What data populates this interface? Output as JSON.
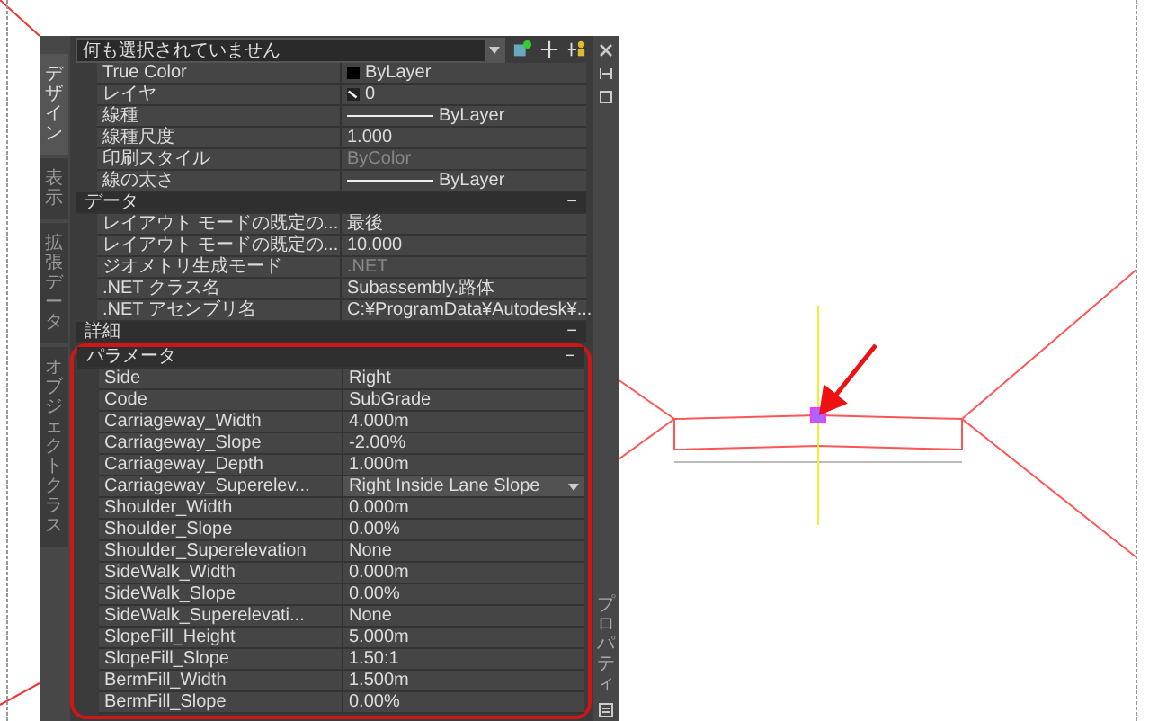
{
  "palette": {
    "selection": "何も選択されていません",
    "side_tabs": [
      {
        "label": "デザイン",
        "selected": true
      },
      {
        "label": "表示",
        "selected": false
      },
      {
        "label": "拡張データ",
        "selected": false
      },
      {
        "label": "オブジェクトクラス",
        "selected": false
      }
    ],
    "side_title": "プロパティ",
    "general_rows": [
      {
        "label": "True Color",
        "value": "ByLayer",
        "kind": "color",
        "disabled": false
      },
      {
        "label": "レイヤ",
        "value": "0",
        "kind": "layer",
        "disabled": false
      },
      {
        "label": "線種",
        "value": "ByLayer",
        "kind": "linetype",
        "disabled": false
      },
      {
        "label": "線種尺度",
        "value": "1.000",
        "kind": "text",
        "disabled": false
      },
      {
        "label": "印刷スタイル",
        "value": "ByColor",
        "kind": "text",
        "disabled": true
      },
      {
        "label": "線の太さ",
        "value": "ByLayer",
        "kind": "linetype",
        "disabled": false
      }
    ],
    "sections": [
      {
        "title": "データ",
        "toggle": "−",
        "highlighted": false,
        "rows": [
          {
            "label": "レイアウト モードの既定の...",
            "value": "最後",
            "kind": "text",
            "disabled": false
          },
          {
            "label": "レイアウト モードの既定の...",
            "value": "10.000",
            "kind": "text",
            "disabled": false
          },
          {
            "label": "ジオメトリ生成モード",
            "value": ".NET",
            "kind": "text",
            "disabled": true
          },
          {
            "label": ".NET クラス名",
            "value": "Subassembly.路体",
            "kind": "text",
            "disabled": false
          },
          {
            "label": ".NET アセンブリ名",
            "value": "C:¥ProgramData¥Autodesk¥...",
            "kind": "text",
            "disabled": false
          }
        ]
      },
      {
        "title": "詳細",
        "toggle": "−",
        "highlighted": false
      },
      {
        "title": "パラメータ",
        "toggle": "−",
        "highlighted": true,
        "rows": [
          {
            "label": "Side",
            "value": "Right",
            "kind": "text",
            "disabled": false
          },
          {
            "label": "Code",
            "value": "SubGrade",
            "kind": "text",
            "disabled": false
          },
          {
            "label": "Carriageway_Width",
            "value": "4.000m",
            "kind": "text",
            "disabled": false
          },
          {
            "label": "Carriageway_Slope",
            "value": "-2.00%",
            "kind": "text",
            "disabled": false
          },
          {
            "label": "Carriageway_Depth",
            "value": "1.000m",
            "kind": "text",
            "disabled": false
          },
          {
            "label": "Carriageway_Superelev...",
            "value": "Right Inside Lane Slope",
            "kind": "dropdown",
            "disabled": false
          },
          {
            "label": "Shoulder_Width",
            "value": "0.000m",
            "kind": "text",
            "disabled": false
          },
          {
            "label": "Shoulder_Slope",
            "value": "0.00%",
            "kind": "text",
            "disabled": false
          },
          {
            "label": "Shoulder_Superelevation",
            "value": "None",
            "kind": "text",
            "disabled": false
          },
          {
            "label": "SideWalk_Width",
            "value": "0.000m",
            "kind": "text",
            "disabled": false
          },
          {
            "label": "SideWalk_Slope",
            "value": "0.00%",
            "kind": "text",
            "disabled": false
          },
          {
            "label": "SideWalk_Superelevati...",
            "value": "None",
            "kind": "text",
            "disabled": false
          },
          {
            "label": "SlopeFill_Height",
            "value": "5.000m",
            "kind": "text",
            "disabled": false
          },
          {
            "label": "SlopeFill_Slope",
            "value": "1.50:1",
            "kind": "text",
            "disabled": false
          },
          {
            "label": "BermFill_Width",
            "value": "1.500m",
            "kind": "text",
            "disabled": false
          },
          {
            "label": "BermFill_Slope",
            "value": "0.00%",
            "kind": "text",
            "disabled": false
          }
        ]
      }
    ]
  }
}
